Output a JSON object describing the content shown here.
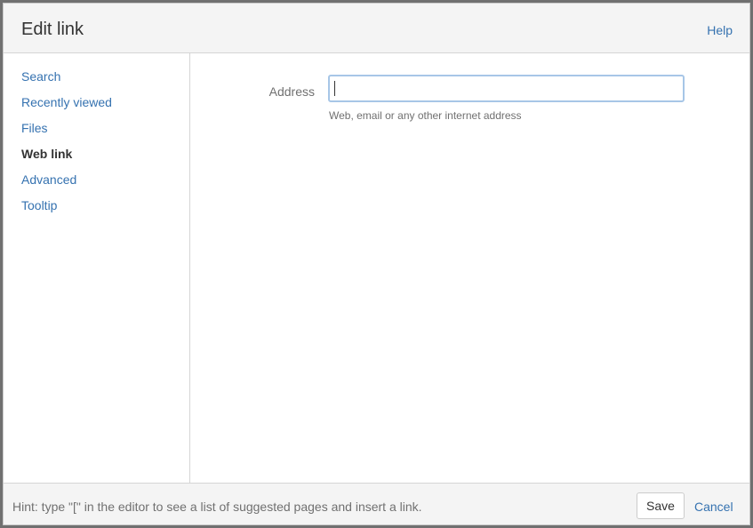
{
  "dialog": {
    "title": "Edit link",
    "help_label": "Help"
  },
  "sidebar": {
    "items": [
      {
        "label": "Search",
        "active": false
      },
      {
        "label": "Recently viewed",
        "active": false
      },
      {
        "label": "Files",
        "active": false
      },
      {
        "label": "Web link",
        "active": true
      },
      {
        "label": "Advanced",
        "active": false
      },
      {
        "label": "Tooltip",
        "active": false
      }
    ]
  },
  "form": {
    "address_label": "Address",
    "address_value": "",
    "address_description": "Web, email or any other internet address"
  },
  "footer": {
    "hint": "Hint: type \"[\" in the editor to see a list of suggested pages and insert a link.",
    "save_label": "Save",
    "cancel_label": "Cancel"
  },
  "colors": {
    "link": "#3572b0",
    "text": "#333333",
    "muted": "#707070",
    "panel_bg": "#f4f4f4",
    "focus_border": "#a7c6e7"
  }
}
